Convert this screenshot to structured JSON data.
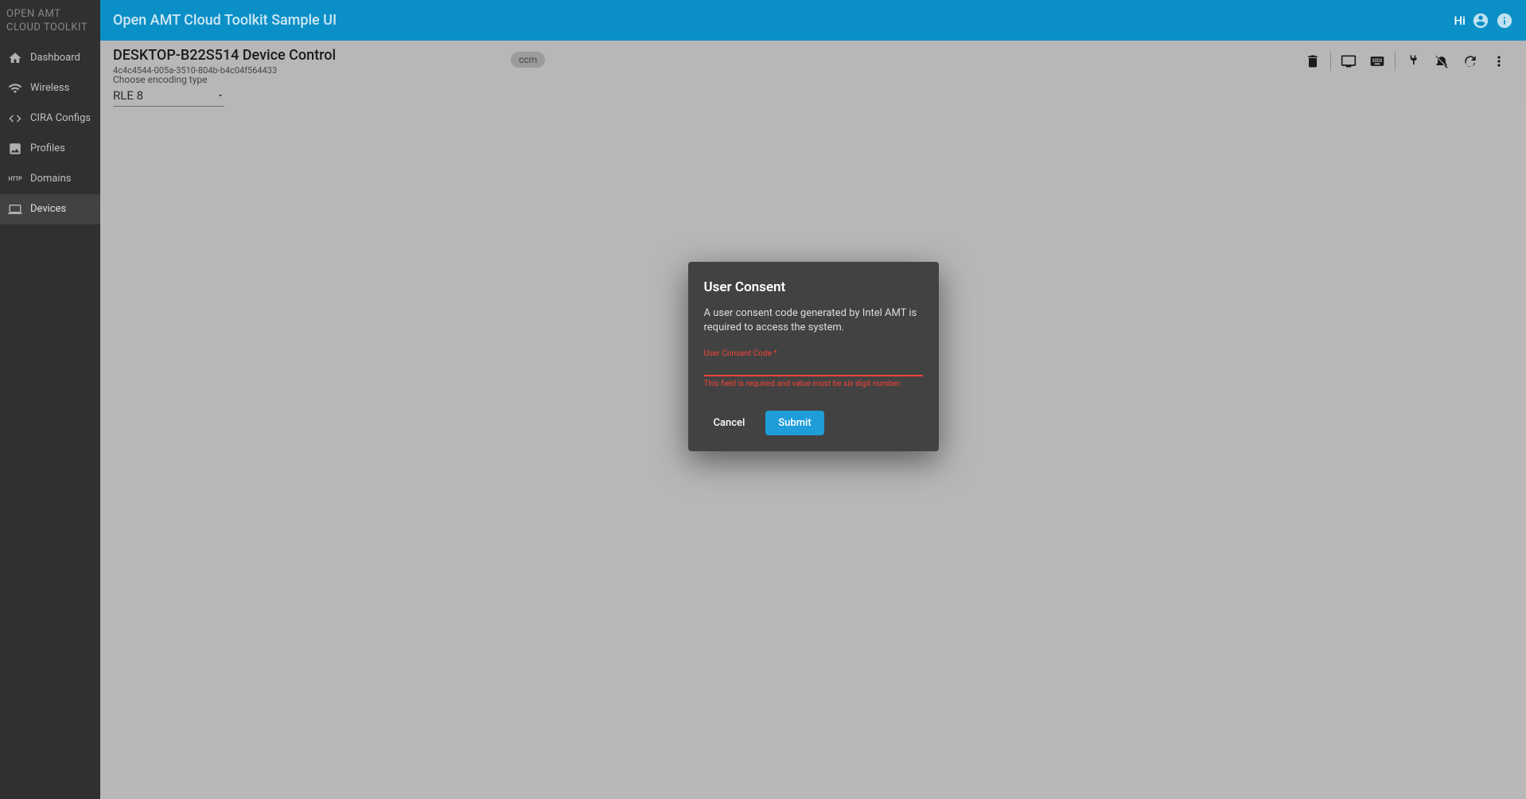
{
  "sidebar": {
    "header": "OPEN AMT CLOUD TOOLKIT",
    "items": [
      {
        "label": "Dashboard",
        "icon": "home-icon"
      },
      {
        "label": "Wireless",
        "icon": "wifi-icon"
      },
      {
        "label": "CIRA Configs",
        "icon": "code-icon"
      },
      {
        "label": "Profiles",
        "icon": "image-icon"
      },
      {
        "label": "Domains",
        "icon": "http-icon"
      },
      {
        "label": "Devices",
        "icon": "laptop-icon"
      }
    ]
  },
  "topbar": {
    "title": "Open AMT Cloud Toolkit Sample UI",
    "greeting": "Hi"
  },
  "device": {
    "name": "DESKTOP-B22S514 Device Control",
    "id": "4c4c4544-005a-3510-804b-b4c04f564433",
    "chip": "ccm"
  },
  "encoding": {
    "label": "Choose encoding type",
    "value": "RLE 8"
  },
  "dialog": {
    "title": "User Consent",
    "text": "A user consent code generated by Intel AMT is required to access the system.",
    "field_label": "User Consent Code *",
    "input_value": "",
    "hint": "This field is required and value must be six digit number.",
    "cancel": "Cancel",
    "submit": "Submit"
  }
}
